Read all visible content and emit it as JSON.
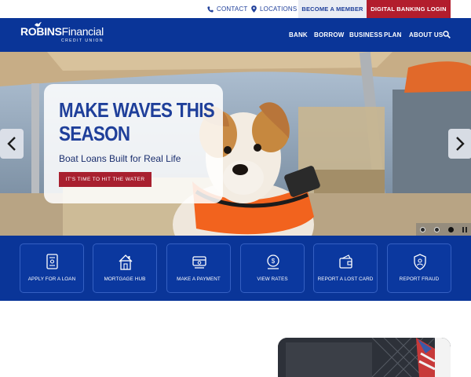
{
  "utility_bar": {
    "contact_label": "CONTACT",
    "locations_label": "LOCATIONS",
    "become_member_label": "BECOME A MEMBER",
    "digital_banking_label": "DIGITAL BANKING LOGIN"
  },
  "header": {
    "logo": {
      "name_bold": "ROBINS",
      "name_light": "Financial",
      "tagline": "CREDIT UNION"
    },
    "nav": [
      "BANK",
      "BORROW",
      "BUSINESS",
      "PLAN",
      "ABOUT US"
    ]
  },
  "hero": {
    "title_line1": "MAKE WAVES THIS",
    "title_line2": "SEASON",
    "subtitle": "Boat Loans Built for Real Life",
    "cta_label": "IT'S TIME TO HIT THE WATER",
    "slide_count": 3,
    "active_slide": 3
  },
  "quick_links": [
    {
      "label": "APPLY FOR A LOAN",
      "icon": "loan-document-icon"
    },
    {
      "label": "MORTGAGE HUB",
      "icon": "house-icon"
    },
    {
      "label": "MAKE A PAYMENT",
      "icon": "payment-icon"
    },
    {
      "label": "VIEW RATES",
      "icon": "rates-icon"
    },
    {
      "label": "REPORT A LOST CARD",
      "icon": "wallet-icon"
    },
    {
      "label": "REPORT FRAUD",
      "icon": "shield-icon"
    }
  ],
  "colors": {
    "brand_blue": "#0a3598",
    "accent_red": "#b21d2d",
    "title_blue": "#1f3f9a"
  }
}
